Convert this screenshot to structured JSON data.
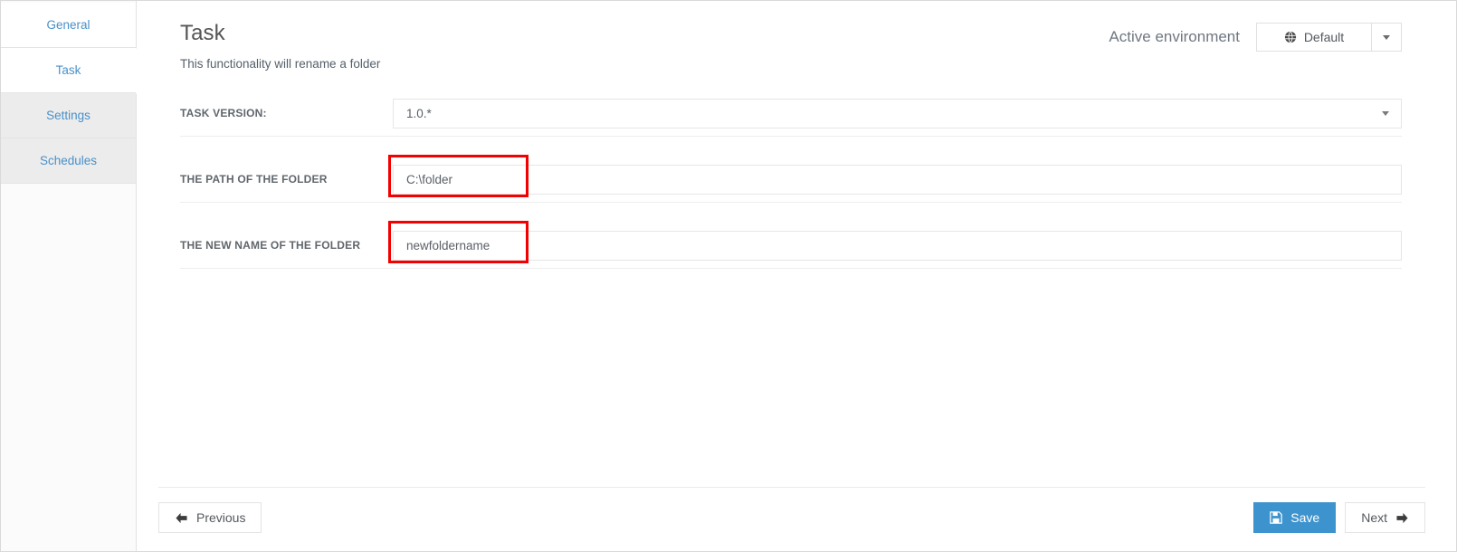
{
  "sidebar": {
    "items": [
      {
        "label": "General",
        "state": "inactive-light",
        "icon": "none"
      },
      {
        "label": "Task",
        "state": "active",
        "icon": "chevron-right-pointer"
      },
      {
        "label": "Settings",
        "state": "inactive-dim",
        "icon": "none"
      },
      {
        "label": "Schedules",
        "state": "inactive-dim",
        "icon": "none"
      }
    ]
  },
  "header": {
    "title": "Task",
    "subtitle": "This functionality will rename a folder",
    "environment_label": "Active environment",
    "environment_value": "Default",
    "environment_icon": "globe-icon",
    "environment_caret_icon": "caret-down-icon"
  },
  "form": {
    "rows": [
      {
        "label": "TASK VERSION:",
        "value": "1.0.*",
        "placeholder": "",
        "control": "select",
        "highlighted": false
      },
      {
        "label": "THE PATH OF THE FOLDER",
        "value": "C:\\folder",
        "placeholder": "",
        "control": "text",
        "highlighted": true
      },
      {
        "label": "THE NEW NAME OF THE FOLDER",
        "value": "newfoldername",
        "placeholder": "",
        "control": "text",
        "highlighted": true
      }
    ]
  },
  "footer": {
    "previous_label": "Previous",
    "previous_icon": "arrow-left-icon",
    "save_label": "Save",
    "save_icon": "floppy-disk-icon",
    "next_label": "Next",
    "next_icon": "arrow-right-icon"
  },
  "colors": {
    "accent_blue": "#3d93cd",
    "nav_link_blue": "#4a90c8",
    "highlight_red": "#f40000",
    "dim_nav_bg": "#ececec",
    "border_grey": "#e6e6e6"
  }
}
